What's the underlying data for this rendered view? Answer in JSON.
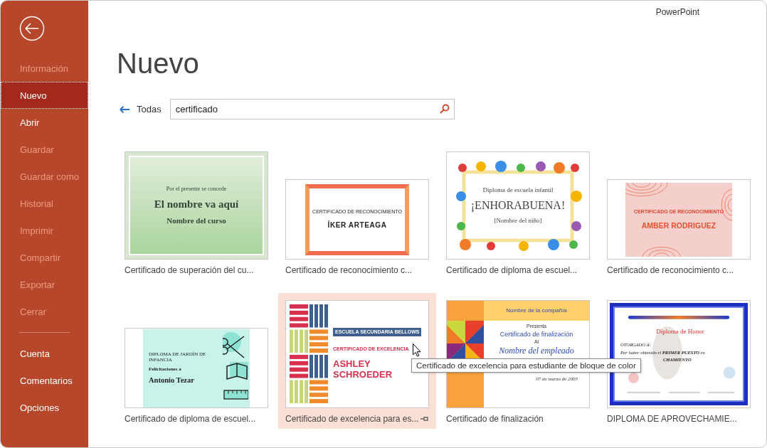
{
  "app_name": "PowerPoint",
  "sidebar": {
    "items": [
      {
        "label": "Información",
        "selected": false,
        "disabled": true
      },
      {
        "label": "Nuevo",
        "selected": true,
        "disabled": false
      },
      {
        "label": "Abrir",
        "selected": false,
        "disabled": false
      },
      {
        "label": "Guardar",
        "selected": false,
        "disabled": true
      },
      {
        "label": "Guardar como",
        "selected": false,
        "disabled": true
      },
      {
        "label": "Historial",
        "selected": false,
        "disabled": true
      },
      {
        "label": "Imprimir",
        "selected": false,
        "disabled": true
      },
      {
        "label": "Compartir",
        "selected": false,
        "disabled": true
      },
      {
        "label": "Exportar",
        "selected": false,
        "disabled": true
      },
      {
        "label": "Cerrar",
        "selected": false,
        "disabled": true
      }
    ],
    "footer_items": [
      {
        "label": "Cuenta",
        "selected": false,
        "disabled": false
      },
      {
        "label": "Comentarios",
        "selected": false,
        "disabled": false
      },
      {
        "label": "Opciones",
        "selected": false,
        "disabled": false
      }
    ]
  },
  "title": "Nuevo",
  "back_link": "Todas",
  "search": {
    "value": "certificado"
  },
  "templates": [
    {
      "kind": "green",
      "label": "Certificado de superación del cu...",
      "highlighted": false,
      "lines": [
        {
          "kind": "heading",
          "text": "Por el presente se concede"
        },
        {
          "kind": "name",
          "text": "El nombre va aquí"
        },
        {
          "kind": "subname",
          "text": "Nombre del curso"
        }
      ]
    },
    {
      "kind": "orange",
      "label": "Certificado de reconocimiento c...",
      "highlighted": false,
      "lines": [
        {
          "kind": "heading",
          "text": "CERTIFICADO DE RECONOCIMIENTO"
        },
        {
          "kind": "name",
          "text": "ÍKER ARTEAGA"
        }
      ]
    },
    {
      "kind": "kids",
      "label": "Certificado de diploma de escuel...",
      "highlighted": false,
      "lines": [
        {
          "kind": "heading",
          "text": "Diploma de escuela infantil"
        },
        {
          "kind": "name",
          "text": "¡ENHORABUENA!"
        },
        {
          "kind": "subname",
          "text": "[Nombre del niño]"
        }
      ]
    },
    {
      "kind": "pink",
      "label": "Certificado de reconocimiento c...",
      "highlighted": false,
      "lines": [
        {
          "kind": "heading",
          "text": "CERTIFICADO DE RECONOCIMIENTO"
        },
        {
          "kind": "name",
          "text": "AMBER RODRIGUEZ"
        }
      ]
    },
    {
      "kind": "teal",
      "label": "Certificado de diploma de escuel...",
      "highlighted": false,
      "lines": [
        {
          "kind": "heading",
          "text": "DIPLOMA DE JARDÍN DE INFANCIA"
        },
        {
          "kind": "text",
          "text": "Felicitaciones a"
        },
        {
          "kind": "name",
          "text": "Antonio Tezar"
        }
      ]
    },
    {
      "kind": "stripes",
      "label": "Certificado de excelencia para es...",
      "highlighted": true,
      "lines": [
        {
          "kind": "badge",
          "text": "ESCUELA SECUNDARIA BELLOWS"
        },
        {
          "kind": "heading",
          "text": "CERTIFICADO DE EXCELENCIA"
        },
        {
          "kind": "name",
          "text": "ASHLEY SCHROEDER"
        }
      ]
    },
    {
      "kind": "balloon",
      "label": "Certificado de finalización",
      "highlighted": false,
      "lines": [
        {
          "kind": "badge",
          "text": "Nombre de la compañía"
        },
        {
          "kind": "text",
          "text": "Presenta"
        },
        {
          "kind": "heading",
          "text": "Certificado de finalización"
        },
        {
          "kind": "text",
          "text": "Al"
        },
        {
          "kind": "name",
          "text": "Nombre del empleado"
        },
        {
          "kind": "date",
          "text": "07 de marzo de 2003"
        }
      ]
    },
    {
      "kind": "honor",
      "label": "DIPLOMA DE APROVECHAMIE...",
      "highlighted": false,
      "lines": [
        {
          "kind": "heading",
          "text": "Diploma de Honor"
        },
        {
          "kind": "text",
          "text": "OTORGADO A:"
        },
        {
          "kind": "text",
          "text": "Por haber obtenido el **PRIMER PUESTO** en"
        },
        {
          "kind": "tail",
          "text": "CHAMIENTO"
        }
      ]
    }
  ],
  "tooltip": {
    "text": "Certificado de excelencia para estudiante de bloque de color"
  }
}
